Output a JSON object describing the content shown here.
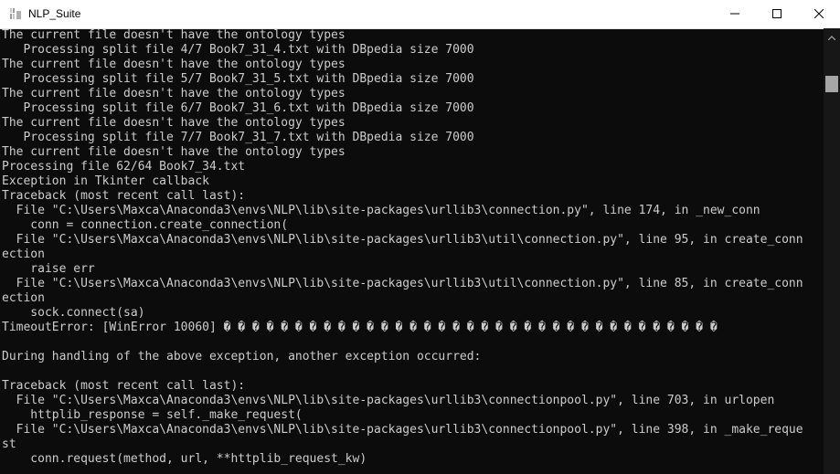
{
  "window": {
    "title": "NLP_Suite"
  },
  "icons": {
    "app": "console-app-icon",
    "minimize": "minimize-icon",
    "maximize": "maximize-icon",
    "close": "close-icon",
    "scroll_up": "chevron-up-icon"
  },
  "colors": {
    "console_bg": "#0c0c0c",
    "console_text": "#cccccc",
    "titlebar_bg": "#ffffff"
  },
  "console": {
    "lines": [
      "The current file doesn't have the ontology types",
      "   Processing split file 4/7 Book7_31_4.txt with DBpedia size 7000",
      "The current file doesn't have the ontology types",
      "   Processing split file 5/7 Book7_31_5.txt with DBpedia size 7000",
      "The current file doesn't have the ontology types",
      "   Processing split file 6/7 Book7_31_6.txt with DBpedia size 7000",
      "The current file doesn't have the ontology types",
      "   Processing split file 7/7 Book7_31_7.txt with DBpedia size 7000",
      "The current file doesn't have the ontology types",
      "Processing file 62/64 Book7_34.txt",
      "Exception in Tkinter callback",
      "Traceback (most recent call last):",
      "  File \"C:\\Users\\Maxca\\Anaconda3\\envs\\NLP\\lib\\site-packages\\urllib3\\connection.py\", line 174, in _new_conn",
      "    conn = connection.create_connection(",
      "  File \"C:\\Users\\Maxca\\Anaconda3\\envs\\NLP\\lib\\site-packages\\urllib3\\util\\connection.py\", line 95, in create_conn",
      "ection",
      "    raise err",
      "  File \"C:\\Users\\Maxca\\Anaconda3\\envs\\NLP\\lib\\site-packages\\urllib3\\util\\connection.py\", line 85, in create_conn",
      "ection",
      "    sock.connect(sa)",
      "TimeoutError: [WinError 10060] � � � � � � � � � � � � � � � � � � � � � � � � � � � � � � � � � � �",
      "",
      "During handling of the above exception, another exception occurred:",
      "",
      "Traceback (most recent call last):",
      "  File \"C:\\Users\\Maxca\\Anaconda3\\envs\\NLP\\lib\\site-packages\\urllib3\\connectionpool.py\", line 703, in urlopen",
      "    httplib_response = self._make_request(",
      "  File \"C:\\Users\\Maxca\\Anaconda3\\envs\\NLP\\lib\\site-packages\\urllib3\\connectionpool.py\", line 398, in _make_reque",
      "st",
      "    conn.request(method, url, **httplib_request_kw)"
    ]
  }
}
